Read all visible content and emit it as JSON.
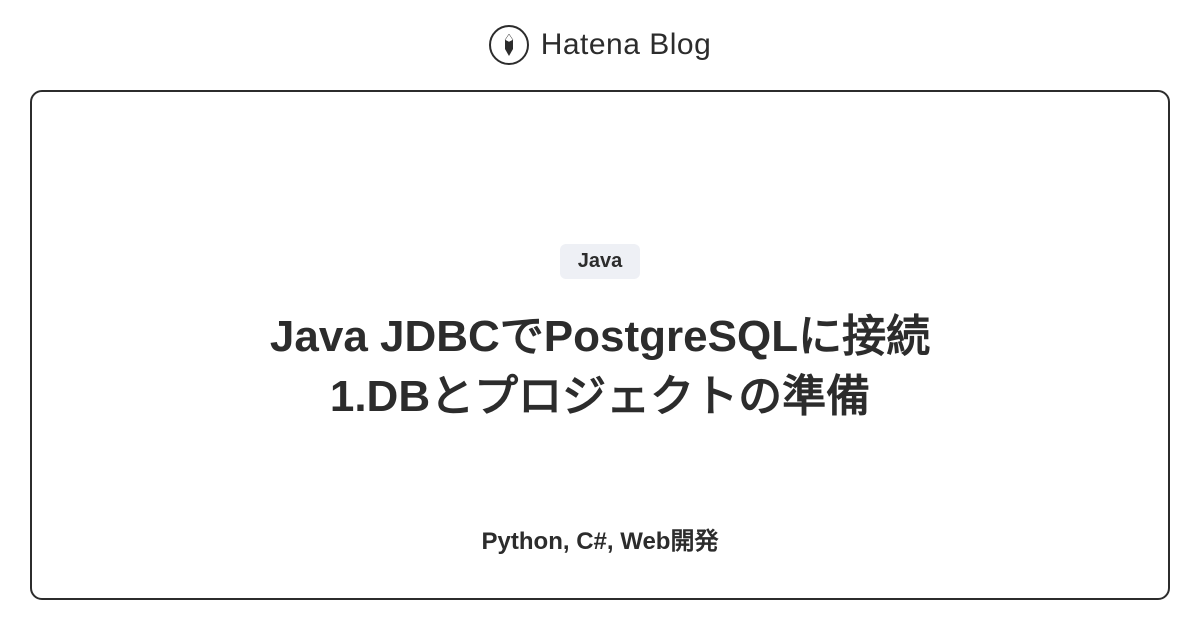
{
  "header": {
    "brand": "Hatena Blog"
  },
  "card": {
    "tag": "Java",
    "title": "Java JDBCでPostgreSQLに接続\n1.DBとプロジェクトの準備",
    "subtitle": "Python, C#, Web開発"
  }
}
